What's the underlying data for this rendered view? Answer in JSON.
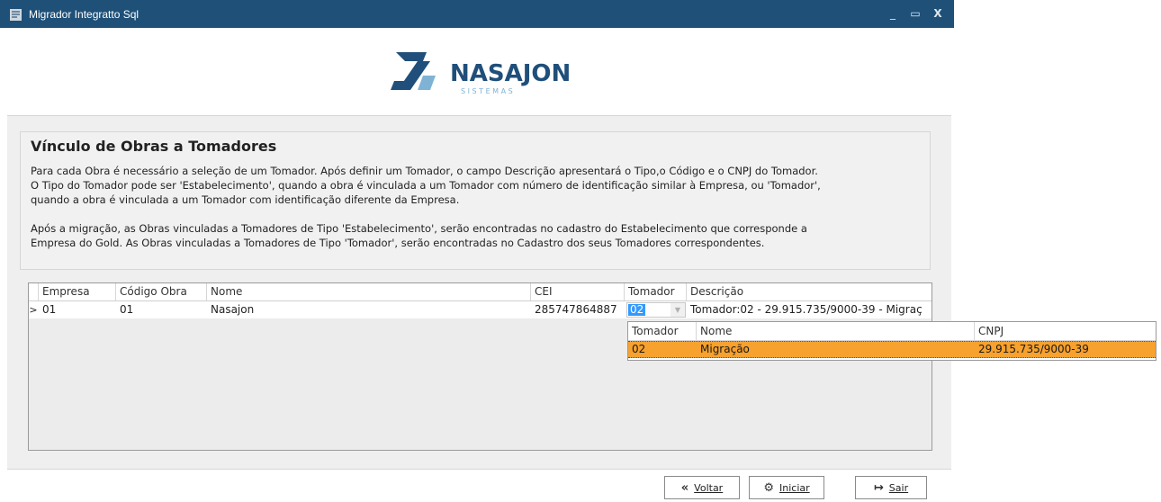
{
  "window": {
    "title": "Migrador Integratto Sql",
    "minimize_label": "_",
    "maximize_label": "▭",
    "close_label": "X"
  },
  "logo": {
    "brand": "NASAJON",
    "tagline": "S I S T E M A S",
    "colors": {
      "primary": "#1f4f7a",
      "accent": "#7fb3d5"
    }
  },
  "info": {
    "title": "Vínculo de Obras a Tomadores",
    "lines": [
      "Para cada Obra é necessário a seleção de um Tomador. Após definir um Tomador, o campo Descrição apresentará o Tipo,o Código e o CNPJ do Tomador.",
      "O Tipo do Tomador pode ser 'Estabelecimento', quando a obra é vinculada a um Tomador com número de identificação similar à Empresa, ou 'Tomador',",
      "quando a obra é vinculada a um Tomador com identificação diferente da Empresa.",
      "Após a migração, as Obras vinculadas a Tomadores de Tipo 'Estabelecimento', serão encontradas no cadastro do Estabelecimento que corresponde a",
      "Empresa do Gold. As Obras vinculadas a Tomadores de Tipo 'Tomador', serão encontradas no Cadastro dos seus Tomadores correspondentes."
    ]
  },
  "grid": {
    "columns": [
      "Empresa",
      "Código Obra",
      "Nome",
      "CEI",
      "Tomador",
      "Descrição"
    ],
    "rows": [
      {
        "indicator": ">",
        "empresa": "01",
        "codigo_obra": "01",
        "nome": "Nasajon",
        "cei": "285747864887",
        "tomador": "02",
        "descricao": "Tomador:02 - 29.915.735/9000-39 - Migraç"
      }
    ]
  },
  "lookup": {
    "columns": [
      "Tomador",
      "Nome",
      "CNPJ"
    ],
    "rows": [
      {
        "tomador": "02",
        "nome": "Migração",
        "cnpj": "29.915.735/9000-39"
      }
    ],
    "highlight_color": "#f7a12e"
  },
  "footer": {
    "voltar_label": "Voltar",
    "iniciar_label": "Iniciar",
    "sair_label": "Sair"
  },
  "colors": {
    "titlebar": "#1f5078",
    "selection": "#3399ff"
  }
}
